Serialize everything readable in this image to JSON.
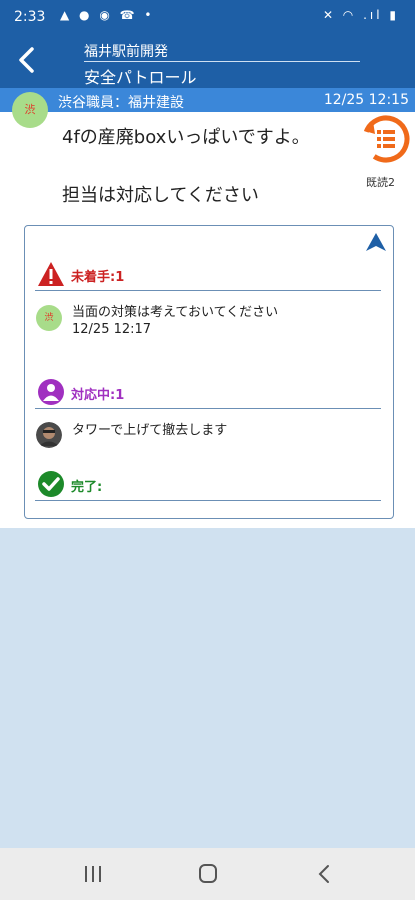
{
  "status_bar": {
    "time": "2:33",
    "left_icons": "▲ ● ◉ ☎ •",
    "right_icons": "✕ ◠ .ıl ▮"
  },
  "header": {
    "project": "福井駅前開発",
    "section": "安全パトロール"
  },
  "post": {
    "avatar_text": "渋",
    "poster": "渋谷職員：福井建設",
    "timestamp": "12/25 12:15",
    "message_line1": "4fの産廃boxいっぱいですよ。",
    "message_line2": "担当は対応してください",
    "read_count": "既読2"
  },
  "status_sections": {
    "unstarted": {
      "label": "未着手:1",
      "color": "#cc2222",
      "item": {
        "avatar_text": "渋",
        "text": "当面の対策は考えておいてください",
        "time": "12/25 12:17"
      }
    },
    "in_progress": {
      "label": "対応中:1",
      "color": "#a030c0",
      "item": {
        "text": "タワーで上げて撤去します"
      }
    },
    "done": {
      "label": "完了:",
      "color": "#1d8a2a"
    }
  },
  "nav_bar": {
    "recent": "recent-apps-icon",
    "home": "home-icon",
    "back": "back-icon"
  }
}
